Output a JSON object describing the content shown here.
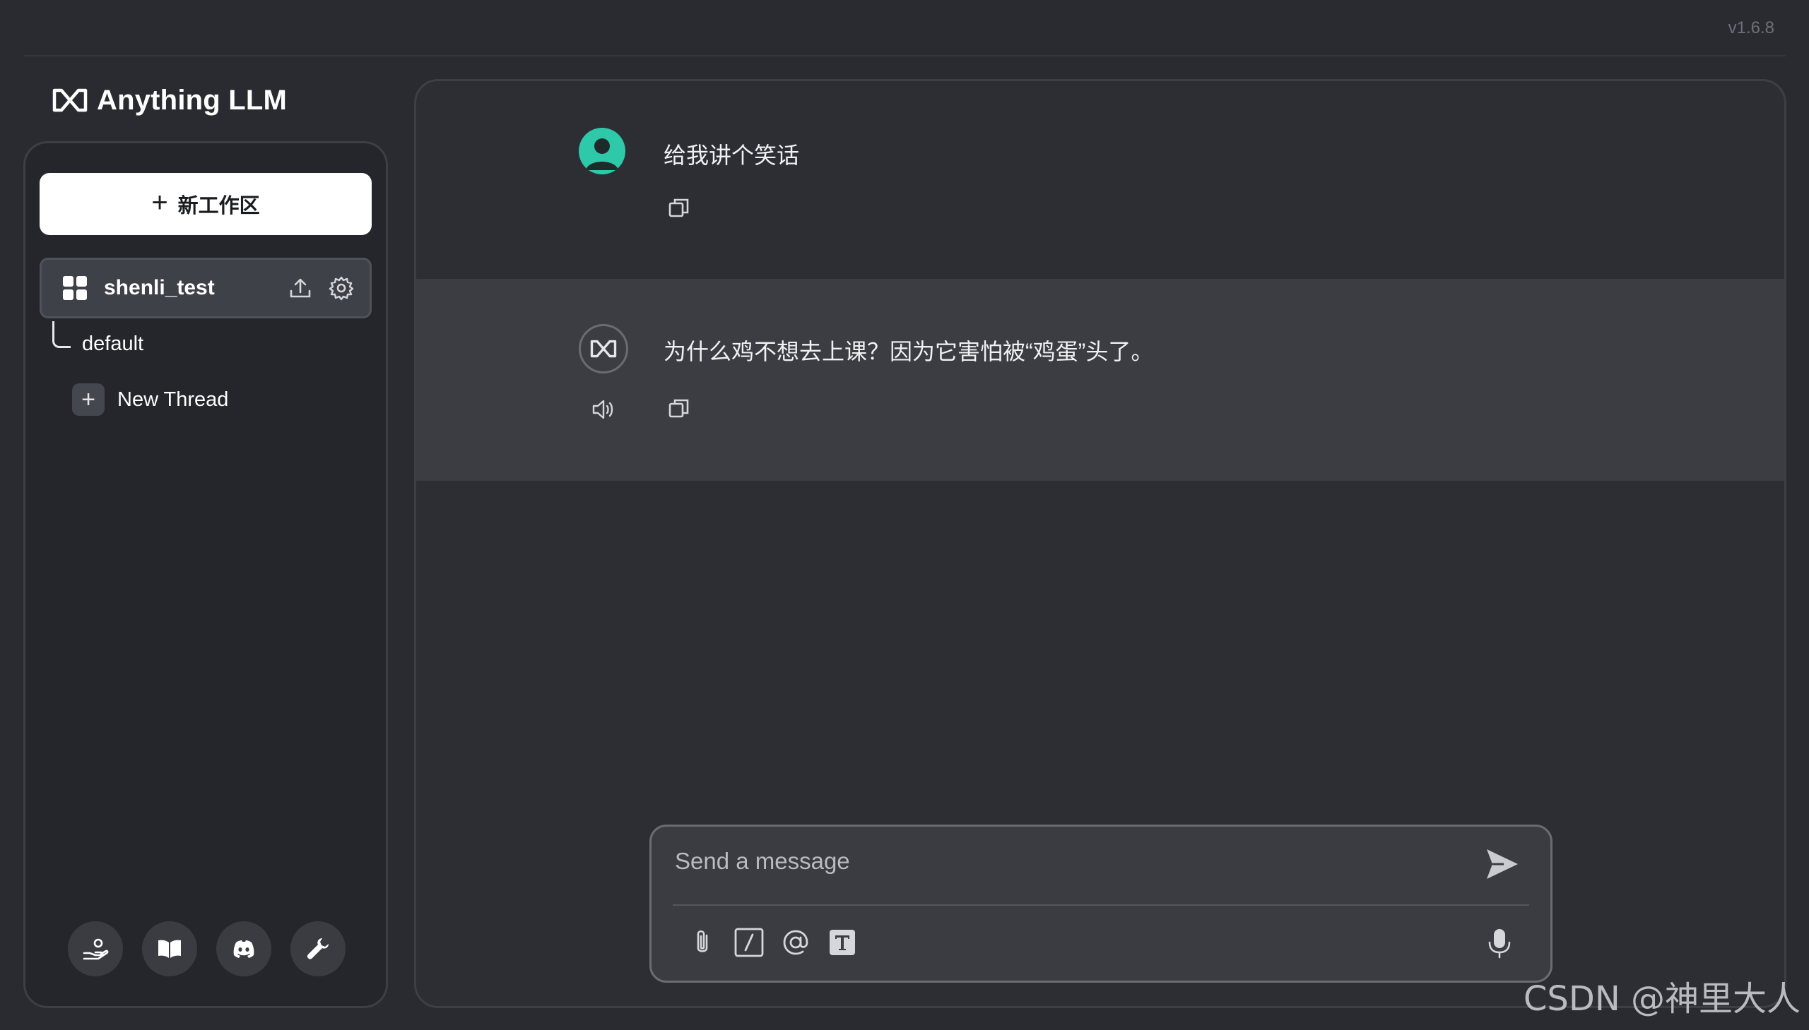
{
  "app": {
    "version": "v1.6.8",
    "logo_text": "Anything LLM"
  },
  "sidebar": {
    "new_workspace_label": "新工作区",
    "workspace": {
      "name": "shenli_test",
      "threads": [
        {
          "label": "default"
        }
      ],
      "new_thread_label": "New Thread"
    },
    "footer_icons": [
      "community-hub-icon",
      "docs-book-icon",
      "discord-icon",
      "settings-wrench-icon"
    ]
  },
  "chat": {
    "messages": [
      {
        "role": "user",
        "text": "给我讲个笑话"
      },
      {
        "role": "assistant",
        "text": "为什么鸡不想去上课？因为它害怕被“鸡蛋”头了。"
      }
    ]
  },
  "composer": {
    "placeholder": "Send a message",
    "tools": [
      "attach-icon",
      "slash-command-icon",
      "mention-icon",
      "text-size-icon"
    ]
  },
  "colors": {
    "background": "#2a2b30",
    "user_avatar": "#2ec9a9",
    "assistant_row": "#3b3d43"
  },
  "watermark": "CSDN @神里大人"
}
